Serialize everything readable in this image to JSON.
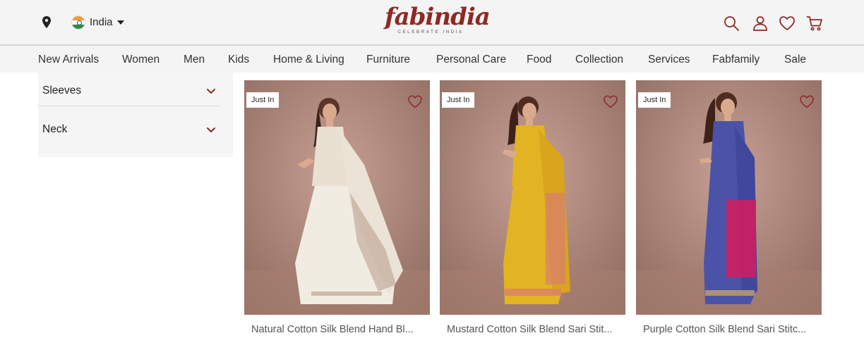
{
  "header": {
    "country": "India",
    "logo_text": "fabindia",
    "logo_tagline": "CELEBRATE INDIA",
    "icons": [
      "location-pin-icon",
      "india-flag-icon",
      "search-icon",
      "user-icon",
      "heart-icon",
      "cart-icon"
    ],
    "brand_color": "#8c2a26"
  },
  "nav": {
    "items": [
      "New Arrivals",
      "Women",
      "Men",
      "Kids",
      "Home & Living",
      "Furniture",
      "Personal Care",
      "Food",
      "Collection",
      "Services",
      "Fabfamily",
      "Sale"
    ]
  },
  "filters": {
    "items": [
      {
        "label": "Sleeves"
      },
      {
        "label": "Neck"
      }
    ]
  },
  "products": [
    {
      "badge": "Just In",
      "name": "Natural Cotton Silk Blend Hand Bl...",
      "saree_color": "#f1ece2",
      "border_color": "#b89a88"
    },
    {
      "badge": "Just In",
      "name": "Mustard Cotton Silk Blend Sari Stit...",
      "saree_color": "#e2b322",
      "border_color": "#d9806b"
    },
    {
      "badge": "Just In",
      "name": "Purple Cotton Silk Blend Sari Stitc...",
      "saree_color": "#4a53a8",
      "border_color": "#d81b5e"
    }
  ]
}
